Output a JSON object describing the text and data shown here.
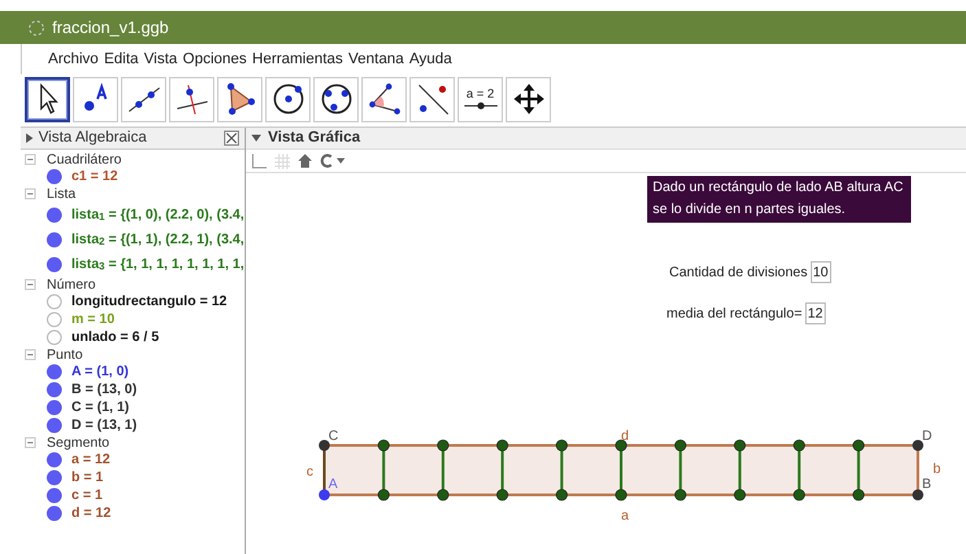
{
  "window": {
    "title": "fraccion_v1.ggb"
  },
  "menu": [
    "Archivo",
    "Edita",
    "Vista",
    "Opciones",
    "Herramientas",
    "Ventana",
    "Ayuda"
  ],
  "tools": [
    {
      "kind": "move",
      "selected": true
    },
    {
      "kind": "point",
      "selected": false
    },
    {
      "kind": "line",
      "selected": false
    },
    {
      "kind": "perpendicular",
      "selected": false
    },
    {
      "kind": "polygon",
      "selected": false
    },
    {
      "kind": "circle",
      "selected": false
    },
    {
      "kind": "circle3",
      "selected": false
    },
    {
      "kind": "angle",
      "selected": false
    },
    {
      "kind": "reflect",
      "selected": false
    },
    {
      "kind": "slider",
      "label": "a = 2",
      "selected": false
    },
    {
      "kind": "pan",
      "selected": false
    }
  ],
  "algebra": {
    "title": "Vista Algebraica",
    "categories": [
      {
        "name": "Cuadrilátero",
        "items": [
          {
            "text": "c1 = 12",
            "color": "#b4532a",
            "shown": true
          }
        ]
      },
      {
        "name": "Lista",
        "items": [
          {
            "text": "lista$_{1}$ = {(1, 0), (2.2, 0), (3.4,",
            "color": "#2a7a1c",
            "shown": true
          },
          {
            "text": "lista$_{2}$ = {(1, 1), (2.2, 1), (3.4,",
            "color": "#2a7a1c",
            "shown": true
          },
          {
            "text": "lista$_{3}$ = {1, 1, 1, 1, 1, 1, 1, 1,",
            "color": "#2a7a1c",
            "shown": true
          }
        ]
      },
      {
        "name": "Número",
        "items": [
          {
            "text": "longitudrectangulo = 12",
            "color": "#1a1a1a",
            "shown": false
          },
          {
            "text": "m = 10",
            "color": "#7aa21c",
            "shown": false
          },
          {
            "text": "unlado = 6 / 5",
            "color": "#1a1a1a",
            "shown": false
          }
        ]
      },
      {
        "name": "Punto",
        "items": [
          {
            "text": "A = (1, 0)",
            "color": "#3434d8",
            "shown": true
          },
          {
            "text": "B = (13, 0)",
            "color": "#333333",
            "shown": true
          },
          {
            "text": "C = (1, 1)",
            "color": "#333333",
            "shown": true
          },
          {
            "text": "D = (13, 1)",
            "color": "#333333",
            "shown": true
          }
        ]
      },
      {
        "name": "Segmento",
        "items": [
          {
            "text": "a = 12",
            "color": "#a0522d",
            "shown": true
          },
          {
            "text": "b = 1",
            "color": "#a0522d",
            "shown": true
          },
          {
            "text": "c = 1",
            "color": "#a0522d",
            "shown": true
          },
          {
            "text": "d = 12",
            "color": "#a0522d",
            "shown": true
          }
        ]
      }
    ]
  },
  "graphics": {
    "title": "Vista Gráfica",
    "note": "Dado un rectángulo de lado AB altura AC se lo divide en n partes iguales.",
    "fields": [
      {
        "label": "Cantidad de divisiones",
        "value": "10"
      },
      {
        "label": "media del rectángulo=",
        "value": "12"
      }
    ],
    "labels": {
      "C": "C",
      "D": "D",
      "A": "A",
      "B": "B",
      "a": "a",
      "b": "b",
      "c": "c",
      "d": "d"
    }
  }
}
